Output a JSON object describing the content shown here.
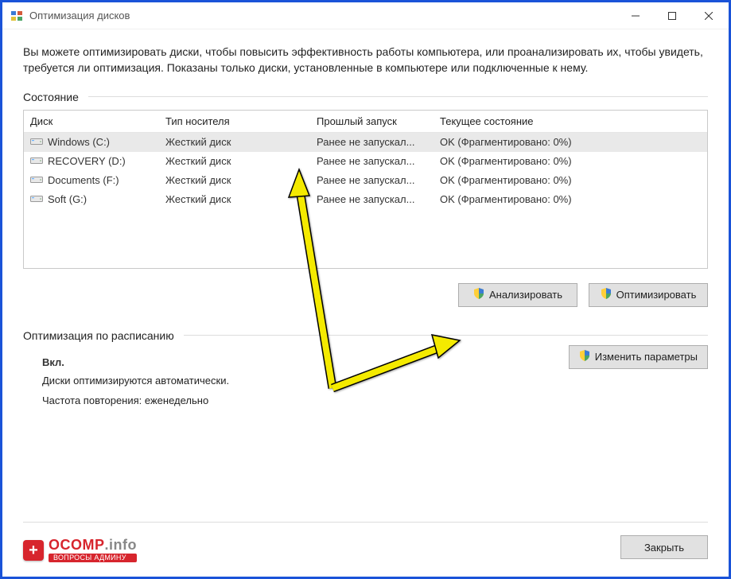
{
  "window": {
    "title": "Оптимизация дисков"
  },
  "intro": "Вы можете оптимизировать диски, чтобы повысить эффективность работы компьютера, или проанализировать их, чтобы увидеть, требуется ли оптимизация. Показаны только диски, установленные в компьютере или подключенные к нему.",
  "sections": {
    "status_label": "Состояние",
    "schedule_label": "Оптимизация по расписанию"
  },
  "columns": {
    "disk": "Диск",
    "media": "Тип носителя",
    "lastrun": "Прошлый запуск",
    "status": "Текущее состояние"
  },
  "rows": [
    {
      "name": "Windows (C:)",
      "media": "Жесткий диск",
      "lastrun": "Ранее не запускал...",
      "status": "OK (Фрагментировано: 0%)",
      "selected": true
    },
    {
      "name": "RECOVERY (D:)",
      "media": "Жесткий диск",
      "lastrun": "Ранее не запускал...",
      "status": "OK (Фрагментировано: 0%)",
      "selected": false
    },
    {
      "name": "Documents (F:)",
      "media": "Жесткий диск",
      "lastrun": "Ранее не запускал...",
      "status": "OK (Фрагментировано: 0%)",
      "selected": false
    },
    {
      "name": "Soft (G:)",
      "media": "Жесткий диск",
      "lastrun": "Ранее не запускал...",
      "status": "OK (Фрагментировано: 0%)",
      "selected": false
    }
  ],
  "buttons": {
    "analyze": "Анализировать",
    "optimize": "Оптимизировать",
    "change": "Изменить параметры",
    "close": "Закрыть"
  },
  "schedule": {
    "status": "Вкл.",
    "line1": "Диски оптимизируются автоматически.",
    "line2": "Частота повторения: еженедельно"
  },
  "branding": {
    "main": "OCOMP",
    "suffix": ".info",
    "sub": "ВОПРОСЫ АДМИНУ"
  }
}
